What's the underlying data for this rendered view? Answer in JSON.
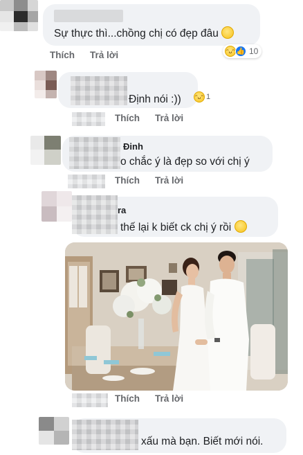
{
  "comments": [
    {
      "text": "Sự thực thì...chồng chị có đẹp đâu",
      "actions": {
        "like": "Thích",
        "reply": "Trả lời"
      },
      "reaction_count": "10"
    },
    {
      "text": "Định nói :))",
      "actions": {
        "like": "Thích",
        "reply": "Trả lời"
      },
      "reaction_count": "1"
    },
    {
      "name_suffix": "Đinh",
      "text": "o chắc ý là đẹp so với chị ý",
      "actions": {
        "like": "Thích",
        "reply": "Trả lời"
      }
    },
    {
      "name_suffix": "ra",
      "text": "thế lại k biết ck chị ý rồi",
      "actions": {
        "like": "Thích",
        "reply": "Trả lời"
      },
      "has_photo": true
    },
    {
      "text": "xấu mà bạn. Biết mới nói."
    }
  ],
  "icons": {
    "slight_smile": "slightly-smiling-face-icon",
    "haha": "haha-reaction-icon",
    "like": "like-reaction-icon"
  },
  "colors": {
    "bubble": "#f0f2f5",
    "action_text": "#65676b",
    "like_blue": "#1877f2"
  }
}
